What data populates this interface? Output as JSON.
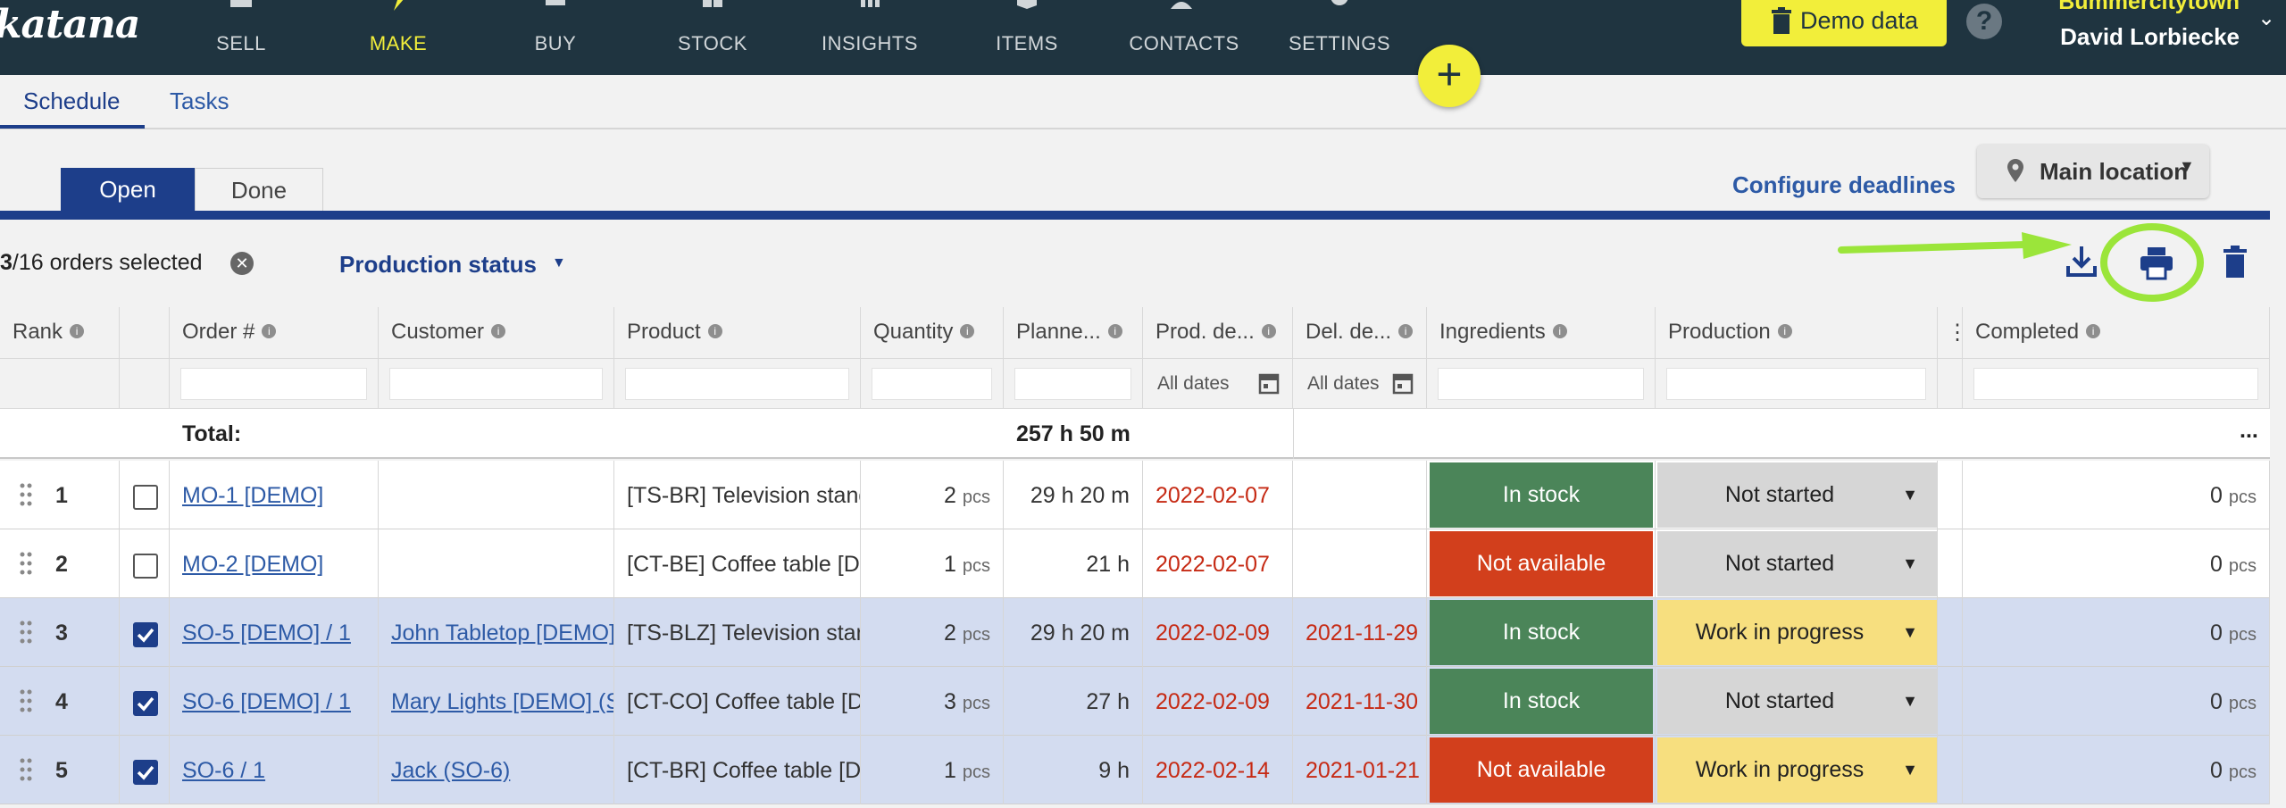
{
  "app": {
    "logo": "katana"
  },
  "nav": {
    "items": [
      {
        "label": "SELL",
        "icon": "shop-icon"
      },
      {
        "label": "MAKE",
        "icon": "make-icon"
      },
      {
        "label": "BUY",
        "icon": "buy-icon"
      },
      {
        "label": "STOCK",
        "icon": "stock-icon"
      },
      {
        "label": "INSIGHTS",
        "icon": "insights-icon"
      },
      {
        "label": "ITEMS",
        "icon": "items-icon"
      },
      {
        "label": "CONTACTS",
        "icon": "contacts-icon"
      },
      {
        "label": "SETTINGS",
        "icon": "gear-icon"
      }
    ],
    "active": "MAKE",
    "demo_label": "Demo data",
    "help": "?",
    "company": "Bummercitytown",
    "user": "David Lorbiecke",
    "fab": "+"
  },
  "tabs": {
    "schedule": "Schedule",
    "tasks": "Tasks"
  },
  "segment": {
    "open": "Open",
    "done": "Done"
  },
  "configure_label": "Configure deadlines",
  "location": {
    "label": "Main location"
  },
  "toolbar": {
    "selected_count": "3",
    "selected_total": "/16",
    "selected_suffix": " orders selected",
    "status_filter": "Production status"
  },
  "table": {
    "headers": {
      "rank": "Rank",
      "order": "Order #",
      "customer": "Customer",
      "product": "Product",
      "quantity": "Quantity",
      "planned": "Planne...",
      "prod_deadline": "Prod. de...",
      "del_deadline": "Del. de...",
      "ingredients": "Ingredients",
      "production": "Production",
      "completed": "Completed"
    },
    "filter_dates": "All dates",
    "total_label": "Total:",
    "total_time": "257 h 50 m",
    "total_more": "...",
    "unit": "pcs",
    "rows": [
      {
        "rank": "1",
        "selected": false,
        "order": "MO-1 [DEMO]",
        "customer": "",
        "product": "[TS-BR] Television stand",
        "qty": "2",
        "planned": "29 h 20 m",
        "prod_deadline": "2022-02-07",
        "del_deadline": "",
        "ingredients": "In stock",
        "production": "Not started",
        "completed": "0"
      },
      {
        "rank": "2",
        "selected": false,
        "order": "MO-2 [DEMO]",
        "customer": "",
        "product": "[CT-BE] Coffee table [DEMO]",
        "qty": "1",
        "planned": "21 h",
        "prod_deadline": "2022-02-07",
        "del_deadline": "",
        "ingredients": "Not available",
        "production": "Not started",
        "completed": "0"
      },
      {
        "rank": "3",
        "selected": true,
        "order": "SO-5 [DEMO] / 1",
        "customer": "John Tabletop [DEMO]",
        "product": "[TS-BLZ] Television stand",
        "qty": "2",
        "planned": "29 h 20 m",
        "prod_deadline": "2022-02-09",
        "del_deadline": "2021-11-29",
        "ingredients": "In stock",
        "production": "Work in progress",
        "completed": "0"
      },
      {
        "rank": "4",
        "selected": true,
        "order": "SO-6 [DEMO] / 1",
        "customer": "Mary Lights [DEMO] (S",
        "product": "[CT-CO] Coffee table [DEMO]",
        "qty": "3",
        "planned": "27 h",
        "prod_deadline": "2022-02-09",
        "del_deadline": "2021-11-30",
        "ingredients": "In stock",
        "production": "Not started",
        "completed": "0"
      },
      {
        "rank": "5",
        "selected": true,
        "order": "SO-6 / 1",
        "customer": "Jack (SO-6)",
        "product": "[CT-BR] Coffee table [DEMO]",
        "qty": "1",
        "planned": "9 h",
        "prod_deadline": "2022-02-14",
        "del_deadline": "2021-01-21",
        "ingredients": "Not available",
        "production": "Work in progress",
        "completed": "0"
      }
    ]
  },
  "colors": {
    "nav_bg": "#1f3440",
    "accent_yellow": "#f2ee3a",
    "primary_blue": "#1d3e8a",
    "in_stock": "#4b8559",
    "not_available": "#d23f1c",
    "wip": "#f7df7f",
    "not_started": "#d6d6d6",
    "selected_row": "#d3dcf0",
    "annotation_green": "#9be53a"
  }
}
